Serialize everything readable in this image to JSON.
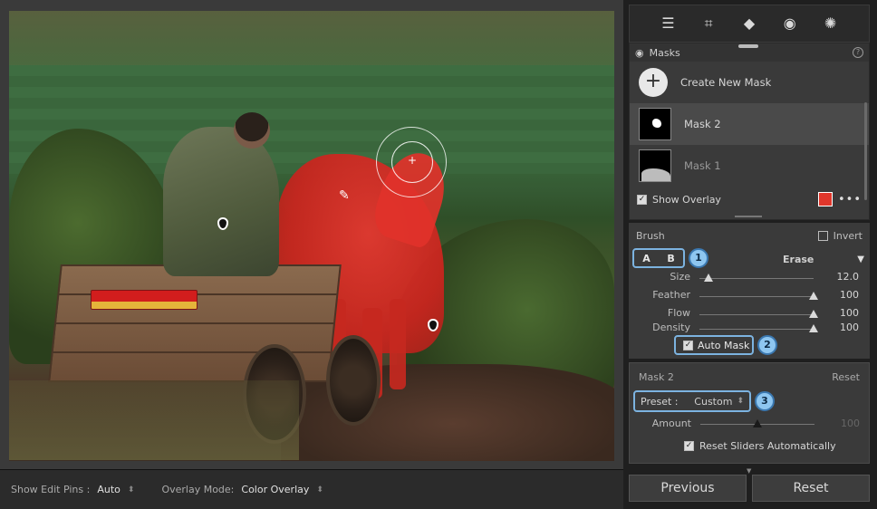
{
  "toolbar": {
    "edit_pins_label": "Show Edit Pins :",
    "edit_pins_value": "Auto",
    "overlay_mode_label": "Overlay Mode:",
    "overlay_mode_value": "Color Overlay"
  },
  "tools": [
    "sliders-icon",
    "crop-icon",
    "eraser-icon",
    "redeye-icon",
    "masking-icon"
  ],
  "masks": {
    "title": "Masks",
    "help": "?",
    "create_label": "Create New Mask",
    "items": [
      {
        "label": "Mask 2"
      },
      {
        "label": "Mask 1"
      }
    ],
    "show_overlay_label": "Show Overlay",
    "overlay_color": "#e0362b"
  },
  "brush": {
    "title": "Brush",
    "invert_label": "Invert",
    "a_label": "A",
    "b_label": "B",
    "erase_label": "Erase",
    "sliders": [
      {
        "label": "Size",
        "value": "12.0",
        "level": 0.08
      },
      {
        "label": "Feather",
        "value": "100",
        "level": 1.0
      },
      {
        "label": "Flow",
        "value": "100",
        "level": 1.0
      },
      {
        "label": "Density",
        "value": "100",
        "level": 1.0
      }
    ],
    "auto_mask_label": "Auto Mask"
  },
  "callouts": [
    "1",
    "2",
    "3"
  ],
  "mask_settings": {
    "title": "Mask 2",
    "reset_label": "Reset",
    "preset_label": "Preset :",
    "preset_value": "Custom",
    "amount_label": "Amount",
    "amount_value": "100",
    "amount_level": 0.5,
    "reset_sliders_label": "Reset Sliders Automatically"
  },
  "buttons": {
    "previous": "Previous",
    "reset": "Reset"
  },
  "colors": {
    "accent": "#7cb3e0",
    "overlay": "#e0362b"
  }
}
